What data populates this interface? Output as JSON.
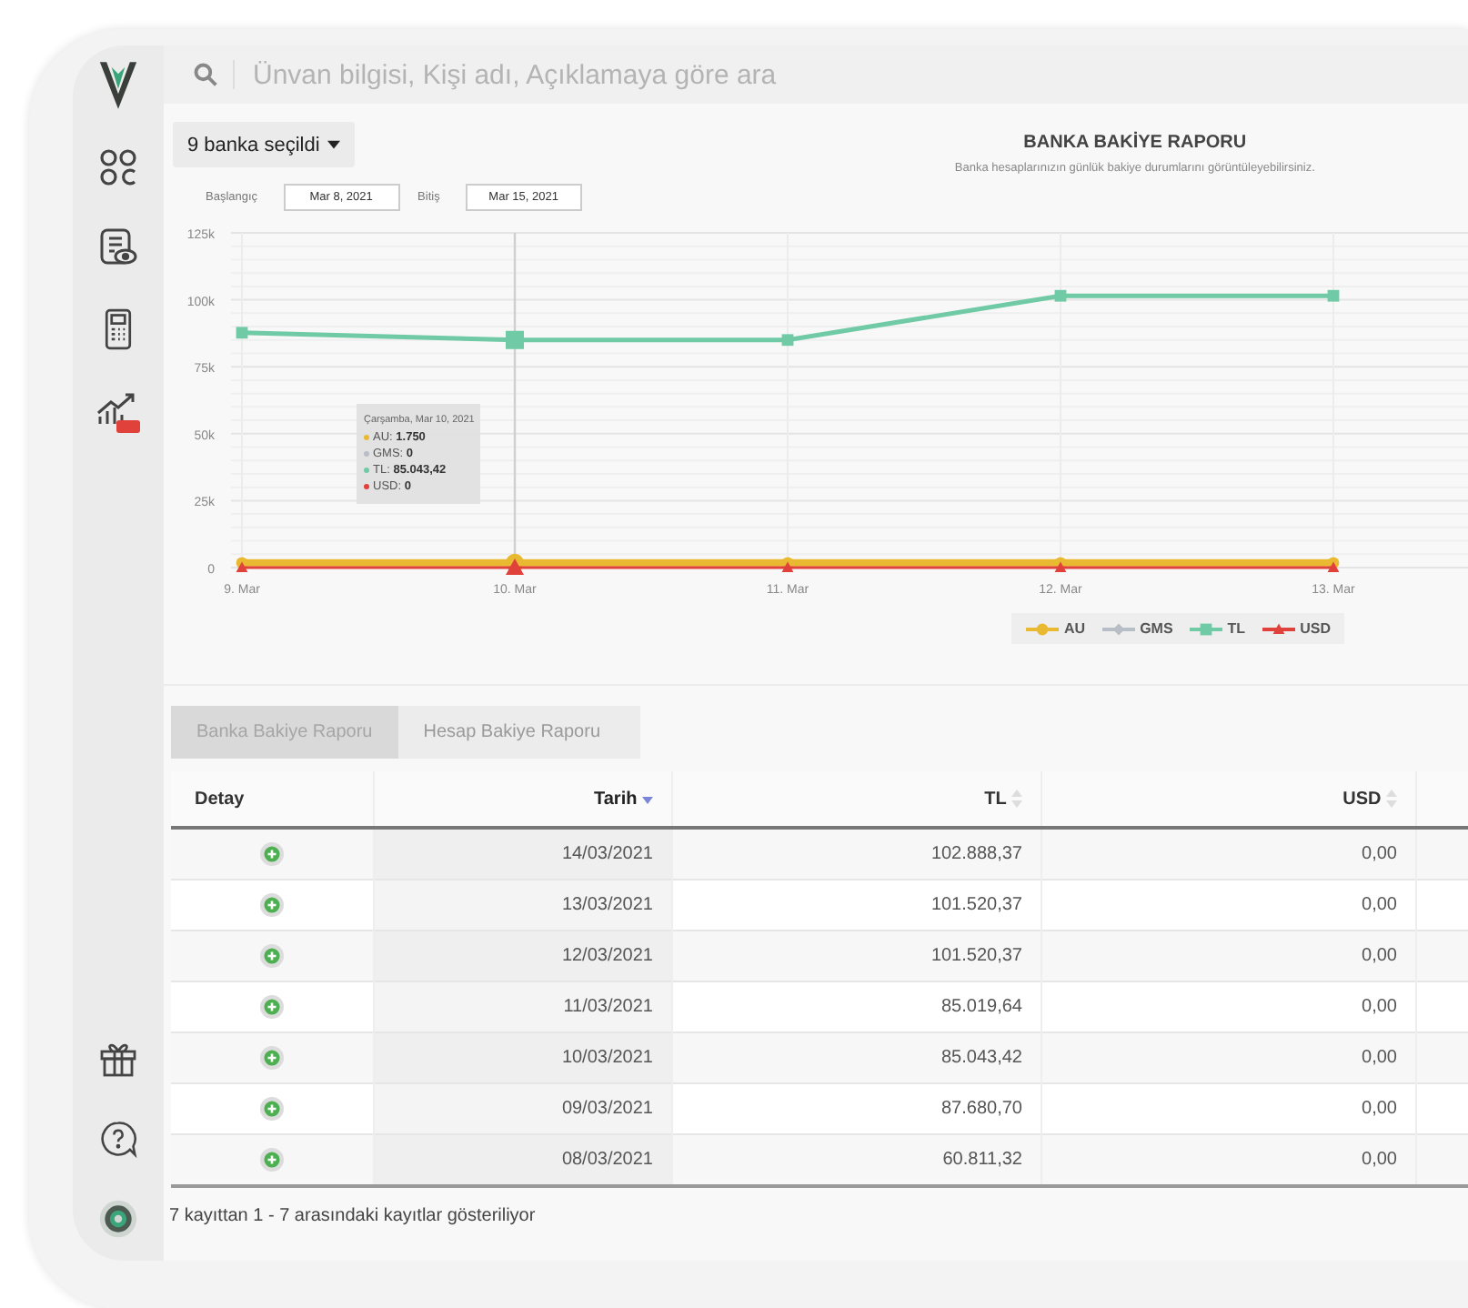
{
  "search": {
    "placeholder": "Ünvan bilgisi, Kişi adı, Açıklamaya göre ara"
  },
  "bank_filter": {
    "label": "9 banka seçildi"
  },
  "report": {
    "title": "BANKA BAKİYE RAPORU",
    "subtitle": "Banka hesaplarınızın günlük bakiye durumlarını görüntüleyebilirsiniz.",
    "date_range": [
      {
        "label": "Başlangıç",
        "value": "Mar 8, 2021"
      },
      {
        "label": "Bitiş",
        "value": "Mar 15, 2021"
      }
    ],
    "chart_data": {
      "type": "line",
      "categories": [
        "9. Mar",
        "10. Mar",
        "11. Mar",
        "12. Mar",
        "13. Mar"
      ],
      "series": [
        {
          "name": "AU",
          "color": "#e8b931",
          "marker": "circle",
          "values": [
            1750,
            1750,
            1750,
            1750,
            1750
          ]
        },
        {
          "name": "GMS",
          "color": "#b8bec6",
          "marker": "diamond",
          "values": [
            null,
            null,
            null,
            null,
            null
          ]
        },
        {
          "name": "TL",
          "color": "#6fcaa5",
          "marker": "square",
          "values": [
            87700,
            85000,
            85000,
            101500,
            101500
          ]
        },
        {
          "name": "USD",
          "color": "#e0413a",
          "marker": "triangle",
          "values": [
            0,
            0,
            0,
            0,
            0
          ]
        }
      ],
      "ylim": [
        0,
        125000
      ],
      "grid": true,
      "legend": true,
      "ref_lines": [
        {
          "axis": "x",
          "value": "10. Mar",
          "color": "#cfcfcf"
        }
      ],
      "yticks": [
        {
          "value": 0,
          "label": "0"
        },
        {
          "value": 25000,
          "label": "25k"
        },
        {
          "value": 50000,
          "label": "50k"
        },
        {
          "value": 75000,
          "label": "75k"
        },
        {
          "value": 100000,
          "label": "100k"
        },
        {
          "value": 125000,
          "label": "125k"
        }
      ]
    },
    "tooltip": {
      "title": "Çarşamba, Mar 10, 2021",
      "items": [
        {
          "text": "AU: **1.750**",
          "color": "#e8b931"
        },
        {
          "text": "GMS: **0**",
          "color": "#b8bec6"
        },
        {
          "text": "TL: **85.043,42**",
          "color": "#6fcaa5"
        },
        {
          "text": "USD: **0**",
          "color": "#e0413a"
        }
      ]
    }
  },
  "tabs": [
    {
      "label": "Banka Bakiye Raporu",
      "selected": true
    },
    {
      "label": "Hesap Bakiye Raporu",
      "selected": false
    }
  ],
  "table": {
    "columns": [
      {
        "label": "Detay",
        "sortable": false,
        "sorted": false
      },
      {
        "label": "Tarih",
        "sortable": true,
        "sorted": true
      },
      {
        "label": "TL",
        "sortable": true,
        "sorted": false
      },
      {
        "label": "USD",
        "sortable": true,
        "sorted": false
      }
    ],
    "rows": [
      {
        "date": "14/03/2021",
        "tl": "102.888,37",
        "usd": "0,00"
      },
      {
        "date": "13/03/2021",
        "tl": "101.520,37",
        "usd": "0,00"
      },
      {
        "date": "12/03/2021",
        "tl": "101.520,37",
        "usd": "0,00"
      },
      {
        "date": "11/03/2021",
        "tl": "85.019,64",
        "usd": "0,00"
      },
      {
        "date": "10/03/2021",
        "tl": "85.043,42",
        "usd": "0,00"
      },
      {
        "date": "09/03/2021",
        "tl": "87.680,70",
        "usd": "0,00"
      },
      {
        "date": "08/03/2021",
        "tl": "60.811,32",
        "usd": "0,00"
      }
    ],
    "footer": "7 kayıttan 1 - 7 arasındaki kayıtlar gösteriliyor"
  }
}
